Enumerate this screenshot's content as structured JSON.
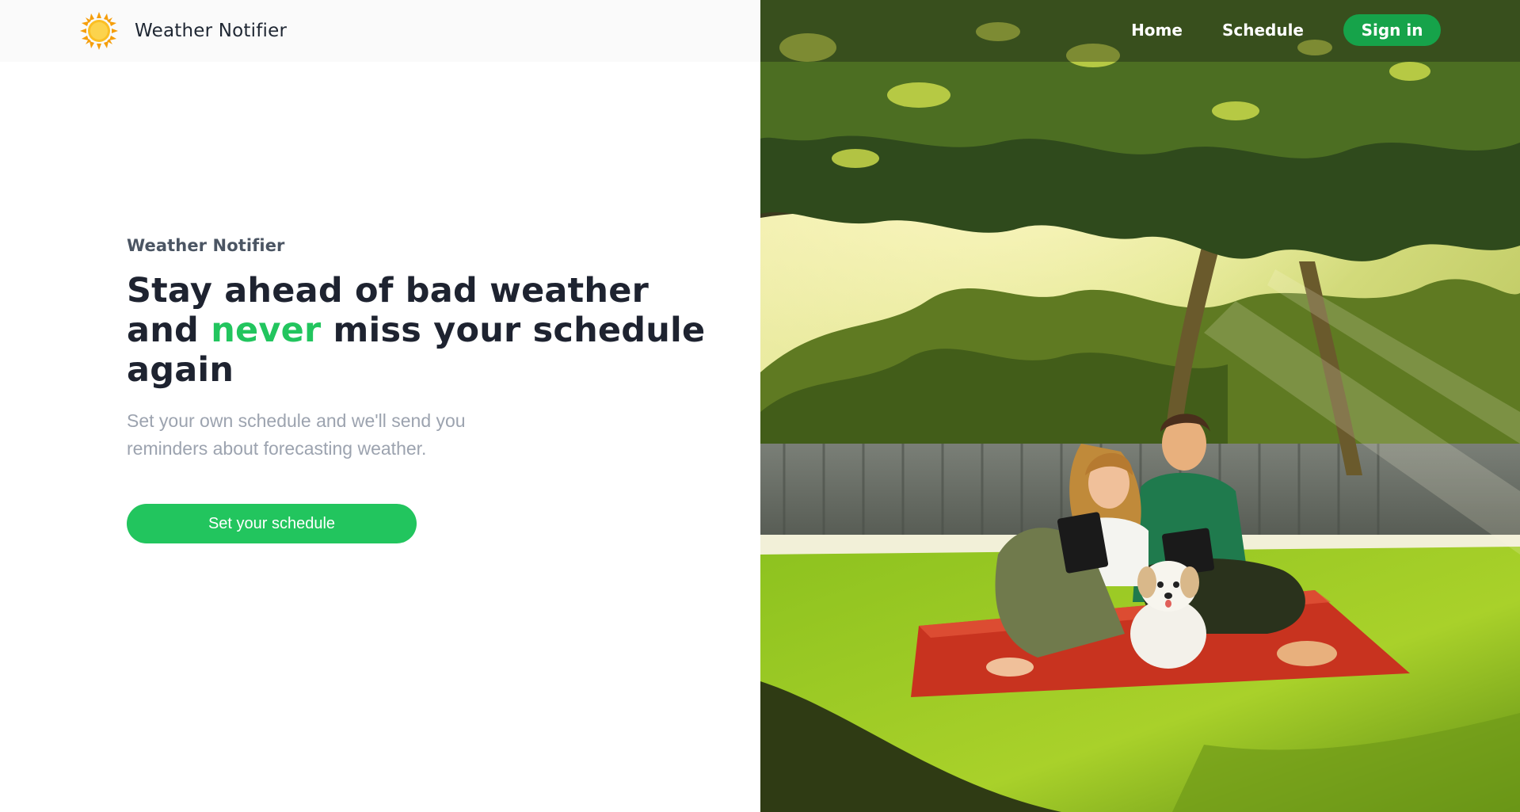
{
  "header": {
    "brand_name": "Weather Notifier",
    "logo_icon": "sun-icon",
    "nav": {
      "home_label": "Home",
      "schedule_label": "Schedule",
      "signin_label": "Sign in"
    }
  },
  "hero": {
    "eyebrow": "Weather Notifier",
    "headline_part1": "Stay ahead of bad weather and ",
    "headline_accent": "never",
    "headline_part2": " miss your schedule again",
    "subtext": "Set your own schedule and we'll send you reminders about forecasting weather.",
    "cta_label": "Set your schedule"
  },
  "illustration": {
    "subject": "couple-with-dog-on-picnic-blanket"
  },
  "colors": {
    "accent_green": "#22c55e",
    "signin_green": "#16a34a",
    "heading_dark": "#1e2330",
    "muted_text": "#9ca3af"
  }
}
